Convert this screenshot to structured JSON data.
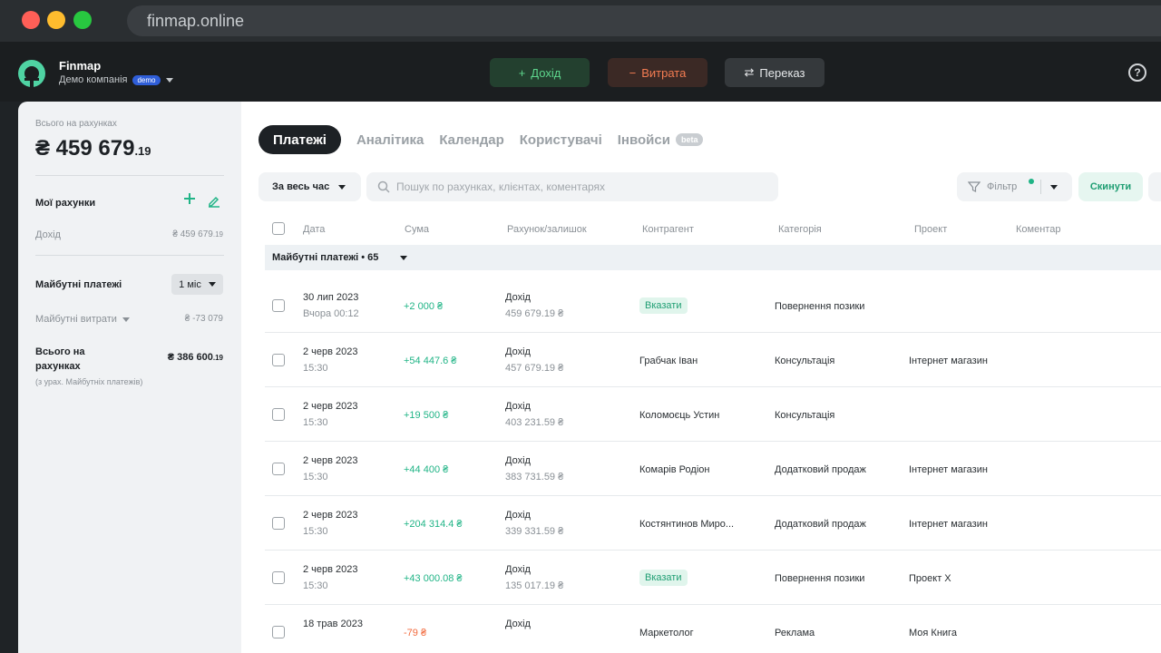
{
  "browser": {
    "url": "finmap.online"
  },
  "header": {
    "brand": "Finmap",
    "company": "Демо компанія",
    "company_badge": "demo",
    "income_btn": "Дохід",
    "expense_btn": "Витрата",
    "transfer_btn": "Переказ",
    "help": "?"
  },
  "sidebar": {
    "total_label": "Всього на рахунках",
    "total_main": "₴ 459 679",
    "total_cents": ".19",
    "accounts_title": "Мої рахунки",
    "account_name": "Дохід",
    "account_value": "₴ 459 679",
    "account_cents": ".19",
    "future_title": "Майбутні платежі",
    "period": "1 міс",
    "future_expenses": "Майбутні витрати",
    "future_expenses_value": "₴ -73 079",
    "total2_label_a": "Всього на",
    "total2_label_b": "рахунках",
    "total2_value": "₴ 386 600",
    "total2_cents": ".19",
    "total2_note": "(з урах. Майбутніх платежів)"
  },
  "tabs": {
    "payments": "Платежі",
    "analytics": "Аналітика",
    "calendar": "Календар",
    "users": "Користувачі",
    "invoices": "Інвойси",
    "beta": "beta"
  },
  "filters": {
    "period": "За весь час",
    "search_placeholder": "Пошук по рахунках, клієнтах, коментарях",
    "filter": "Фільтр",
    "reset": "Скинути"
  },
  "table": {
    "headers": {
      "date": "Дата",
      "amount": "Сума",
      "account": "Рахунок/залишок",
      "counterparty": "Контрагент",
      "category": "Категорія",
      "project": "Проект",
      "comment": "Коментар"
    },
    "group": "Майбутні платежі • 65",
    "rows": [
      {
        "date": "30 лип 2023",
        "time": "Вчора 00:12",
        "amount": "+2 000 ₴",
        "account": "Дохід",
        "balance": "459 679.19 ₴",
        "counterparty": "Вказати",
        "category": "Повернення позики",
        "project": ""
      },
      {
        "date": "2 черв 2023",
        "time": "15:30",
        "amount": "+54 447.6 ₴",
        "account": "Дохід",
        "balance": "457 679.19 ₴",
        "counterparty": "Грабчак Іван",
        "category": "Консультація",
        "project": "Інтернет магазин"
      },
      {
        "date": "2 черв 2023",
        "time": "15:30",
        "amount": "+19 500 ₴",
        "account": "Дохід",
        "balance": "403 231.59 ₴",
        "counterparty": "Коломоєць Устин",
        "category": "Консультація",
        "project": ""
      },
      {
        "date": "2 черв 2023",
        "time": "15:30",
        "amount": "+44 400 ₴",
        "account": "Дохід",
        "balance": "383 731.59 ₴",
        "counterparty": "Комарів Родіон",
        "category": "Додатковий продаж",
        "project": "Інтернет магазин"
      },
      {
        "date": "2 черв 2023",
        "time": "15:30",
        "amount": "+204 314.4 ₴",
        "account": "Дохід",
        "balance": "339 331.59 ₴",
        "counterparty": "Костянтинов Миро...",
        "category": "Додатковий продаж",
        "project": "Інтернет магазин"
      },
      {
        "date": "2 черв 2023",
        "time": "15:30",
        "amount": "+43 000.08 ₴",
        "account": "Дохід",
        "balance": "135 017.19 ₴",
        "counterparty": "Вказати",
        "category": "Повернення позики",
        "project": "Проект X"
      },
      {
        "date": "18 трав 2023",
        "time": "",
        "amount": "-79 ₴",
        "account": "Дохід",
        "balance": "",
        "counterparty": "Маркетолог",
        "category": "Реклама",
        "project": "Моя Книга"
      }
    ]
  },
  "colors": {
    "accent": "#20b486",
    "negative": "#f26a3d",
    "dark": "#1b1e20"
  }
}
